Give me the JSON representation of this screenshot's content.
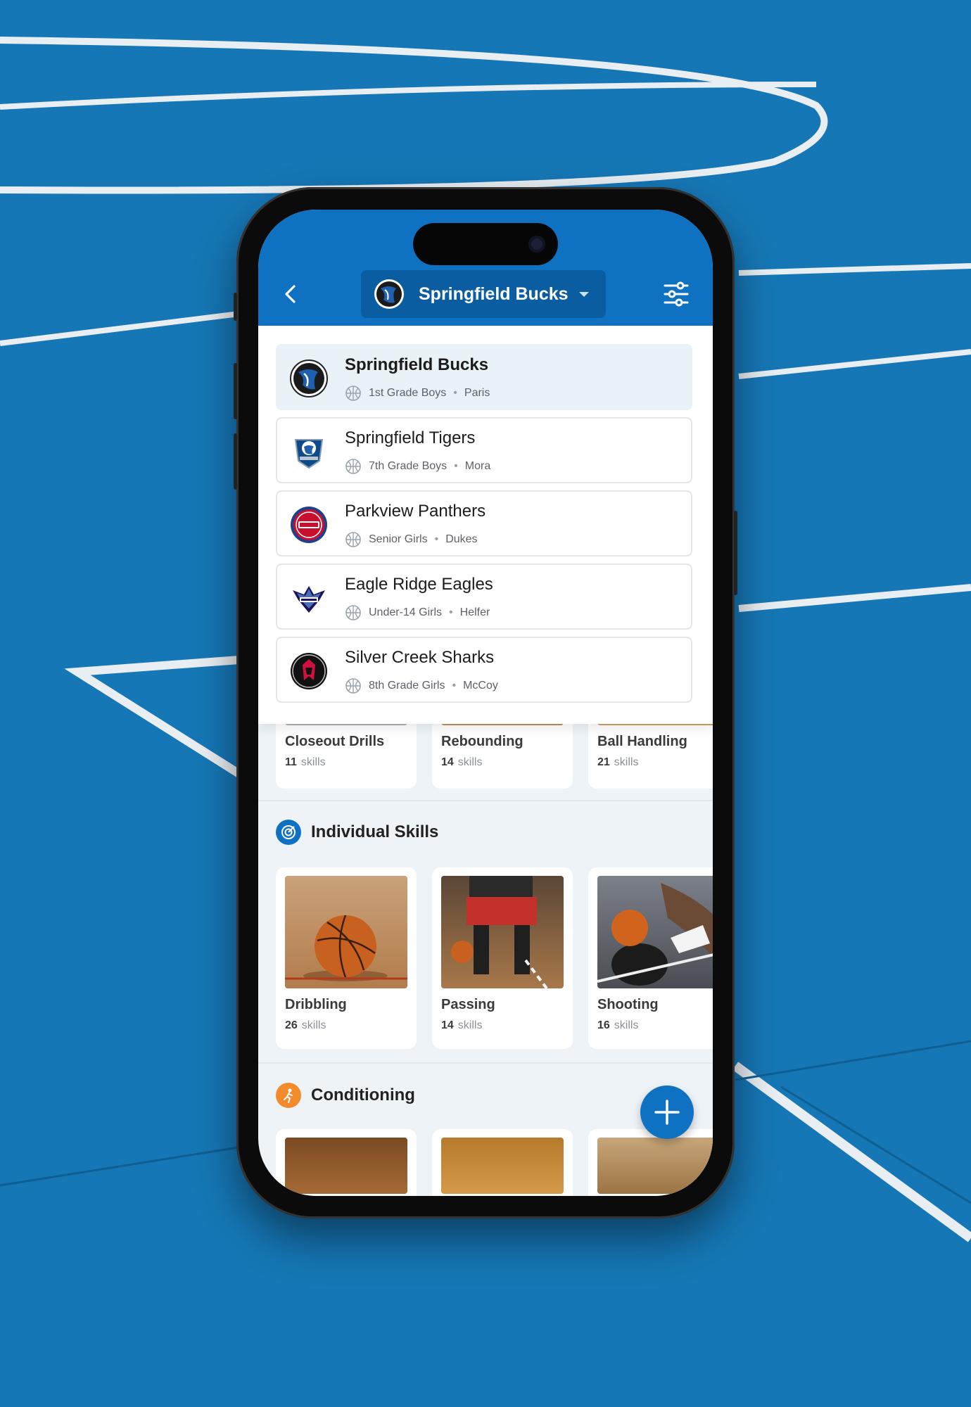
{
  "colors": {
    "court": "#1677b6",
    "header": "#0e71c2",
    "accent": "#0e71c2",
    "conditioning": "#f28b2c"
  },
  "header": {
    "back_icon": "chevron-left-icon",
    "selected_team": "Springfield Bucks",
    "filter_icon": "sliders-icon"
  },
  "teams": [
    {
      "name": "Springfield Bucks",
      "division": "1st Grade Boys",
      "coach": "Paris",
      "selected": true
    },
    {
      "name": "Springfield Tigers",
      "division": "7th Grade Boys",
      "coach": "Mora",
      "selected": false
    },
    {
      "name": "Parkview Panthers",
      "division": "Senior Girls",
      "coach": "Dukes",
      "selected": false
    },
    {
      "name": "Eagle Ridge Eagles",
      "division": "Under-14 Girls",
      "coach": "Helfer",
      "selected": false
    },
    {
      "name": "Silver Creek Sharks",
      "division": "8th Grade Girls",
      "coach": "McCoy",
      "selected": false
    }
  ],
  "team_drills": [
    {
      "title": "Closeout Drills",
      "count": "11",
      "unit": "skills"
    },
    {
      "title": "Rebounding",
      "count": "14",
      "unit": "skills"
    },
    {
      "title": "Ball Handling",
      "count": "21",
      "unit": "skills"
    }
  ],
  "sections": {
    "individual": {
      "label": "Individual Skills",
      "icon": "target-icon"
    },
    "conditioning": {
      "label": "Conditioning",
      "icon": "runner-icon"
    }
  },
  "individual_skills": [
    {
      "title": "Dribbling",
      "count": "26",
      "unit": "skills"
    },
    {
      "title": "Passing",
      "count": "14",
      "unit": "skills"
    },
    {
      "title": "Shooting",
      "count": "16",
      "unit": "skills"
    }
  ],
  "fab": {
    "icon": "plus-icon"
  }
}
